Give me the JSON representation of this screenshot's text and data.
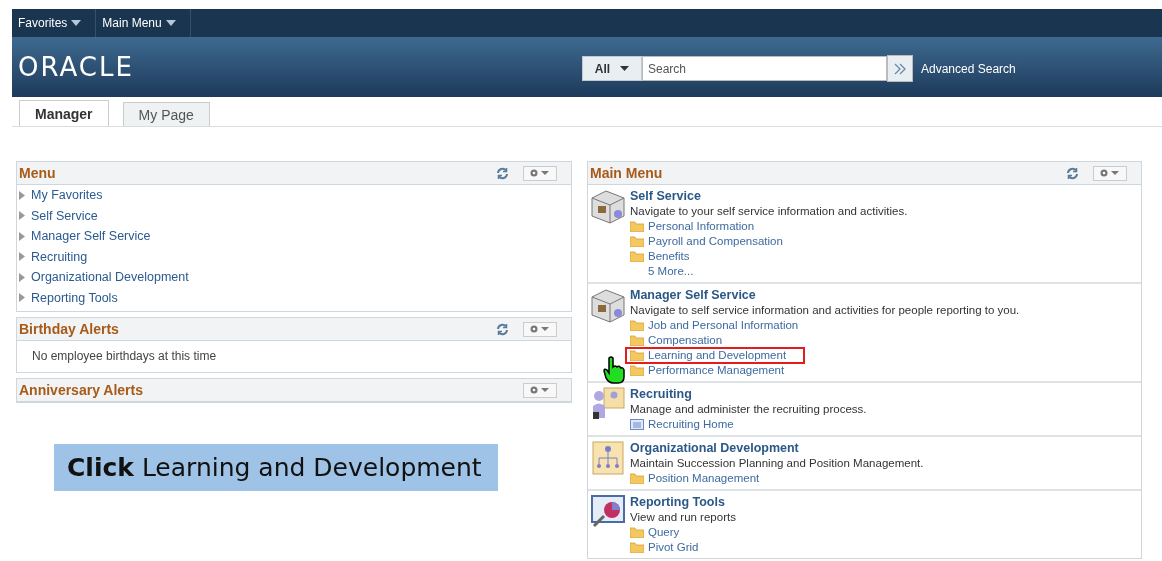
{
  "top_nav": [
    {
      "label": "Favorites"
    },
    {
      "label": "Main Menu"
    }
  ],
  "logo": "ORACLE",
  "search": {
    "scope": "All",
    "placeholder": "Search",
    "advanced_link": "Advanced Search"
  },
  "tabs": [
    {
      "label": "Manager",
      "selected": true
    },
    {
      "label": "My Page",
      "selected": false
    }
  ],
  "left_pagelets": [
    {
      "title": "Menu",
      "refresh": true,
      "kind": "tree",
      "items": [
        "My Favorites",
        "Self Service",
        "Manager Self Service",
        "Recruiting",
        "Organizational Development",
        "Reporting Tools"
      ]
    },
    {
      "title": "Birthday Alerts",
      "refresh": true,
      "kind": "message",
      "message": "No employee birthdays at this time"
    },
    {
      "title": "Anniversary Alerts",
      "refresh": false,
      "kind": "empty"
    }
  ],
  "main_menu": {
    "title": "Main Menu",
    "refresh": true,
    "sections": [
      {
        "title": "Self Service",
        "description": "Navigate to your self service information and activities.",
        "links": [
          {
            "label": "Personal Information",
            "kind": "folder",
            "highlighted": false
          },
          {
            "label": "Payroll and Compensation",
            "kind": "folder",
            "highlighted": false
          },
          {
            "label": "Benefits",
            "kind": "folder",
            "highlighted": false
          },
          {
            "label": "5 More...",
            "kind": "more",
            "highlighted": false
          }
        ]
      },
      {
        "title": "Manager Self Service",
        "description": "Navigate to self service information and activities for people reporting to you.",
        "links": [
          {
            "label": "Job and Personal Information",
            "kind": "folder",
            "highlighted": false
          },
          {
            "label": "Compensation",
            "kind": "folder",
            "highlighted": false
          },
          {
            "label": "Learning and Development",
            "kind": "folder",
            "highlighted": true
          },
          {
            "label": "Performance Management",
            "kind": "folder",
            "highlighted": false
          }
        ]
      },
      {
        "title": "Recruiting",
        "description": "Manage and administer the recruiting process.",
        "links": [
          {
            "label": "Recruiting Home",
            "kind": "page",
            "highlighted": false
          }
        ]
      },
      {
        "title": "Organizational Development",
        "description": "Maintain Succession Planning and Position Management.",
        "links": [
          {
            "label": "Position Management",
            "kind": "folder",
            "highlighted": false
          }
        ]
      },
      {
        "title": "Reporting Tools",
        "description": "View and run reports",
        "links": [
          {
            "label": "Query",
            "kind": "folder",
            "highlighted": false
          },
          {
            "label": "Pivot Grid",
            "kind": "folder",
            "highlighted": false
          }
        ]
      }
    ]
  },
  "callout": "**Click** Learning and Development"
}
